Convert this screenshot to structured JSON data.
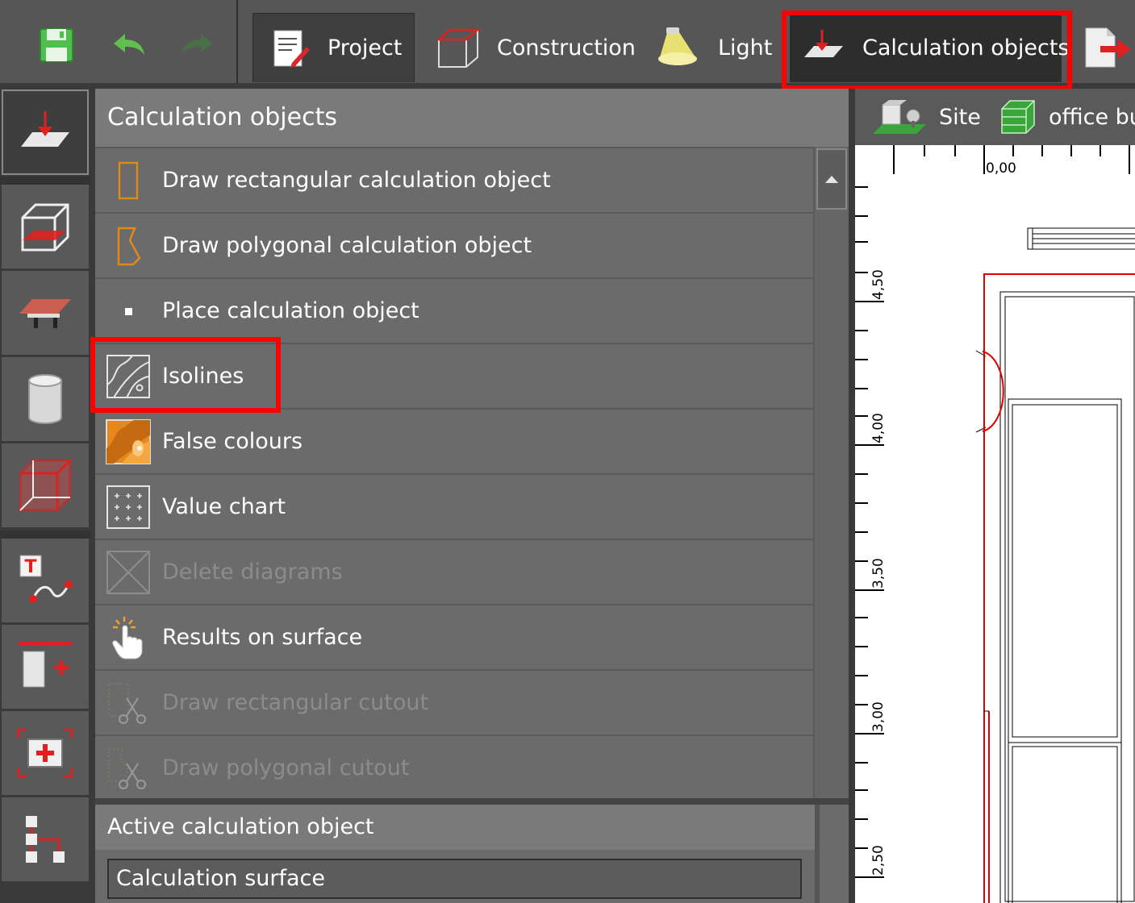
{
  "toolbar": {
    "save_icon": "save-icon",
    "undo_icon": "undo-icon",
    "redo_icon": "redo-icon",
    "tabs": [
      {
        "label": "Project",
        "icon": "project-icon"
      },
      {
        "label": "Construction",
        "icon": "construction-icon"
      },
      {
        "label": "Light",
        "icon": "light-icon"
      },
      {
        "label": "Calculation objects",
        "icon": "calculation-objects-icon"
      },
      {
        "label": "",
        "icon": "export-icon"
      }
    ],
    "active_tab": "Calculation objects"
  },
  "sidebar": {
    "items": [
      {
        "name": "calculation-objects"
      },
      {
        "name": "room-construction"
      },
      {
        "name": "furniture"
      },
      {
        "name": "cylinder"
      },
      {
        "name": "room-objects"
      },
      {
        "name": "text-annotation"
      },
      {
        "name": "add-element"
      },
      {
        "name": "add-view"
      },
      {
        "name": "hierarchy"
      }
    ]
  },
  "panel": {
    "title": "Calculation objects",
    "items": [
      {
        "label": "Draw rectangular calculation object",
        "icon": "rectangle-outline-icon",
        "enabled": true
      },
      {
        "label": "Draw polygonal calculation object",
        "icon": "polygon-outline-icon",
        "enabled": true
      },
      {
        "label": "Place calculation object",
        "icon": "point-icon",
        "enabled": true
      },
      {
        "label": "Isolines",
        "icon": "isolines-icon",
        "enabled": true
      },
      {
        "label": "False colours",
        "icon": "false-colours-icon",
        "enabled": true
      },
      {
        "label": "Value chart",
        "icon": "value-chart-icon",
        "enabled": true
      },
      {
        "label": "Delete diagrams",
        "icon": "delete-diagrams-icon",
        "enabled": false
      },
      {
        "label": "Results on surface",
        "icon": "pointer-hand-icon",
        "enabled": true
      },
      {
        "label": "Draw rectangular cutout",
        "icon": "rectangular-cutout-icon",
        "enabled": false
      },
      {
        "label": "Draw polygonal cutout",
        "icon": "polygonal-cutout-icon",
        "enabled": false
      }
    ],
    "active_header": "Active calculation object",
    "active_value": "Calculation surface"
  },
  "view": {
    "site_label": "Site",
    "building_label": "office bui",
    "ruler_top": [
      "0,00"
    ],
    "ruler_left": [
      "4,50",
      "4,00",
      "3,50",
      "3,00",
      "2,50"
    ]
  },
  "highlight_color": "#ff0000"
}
